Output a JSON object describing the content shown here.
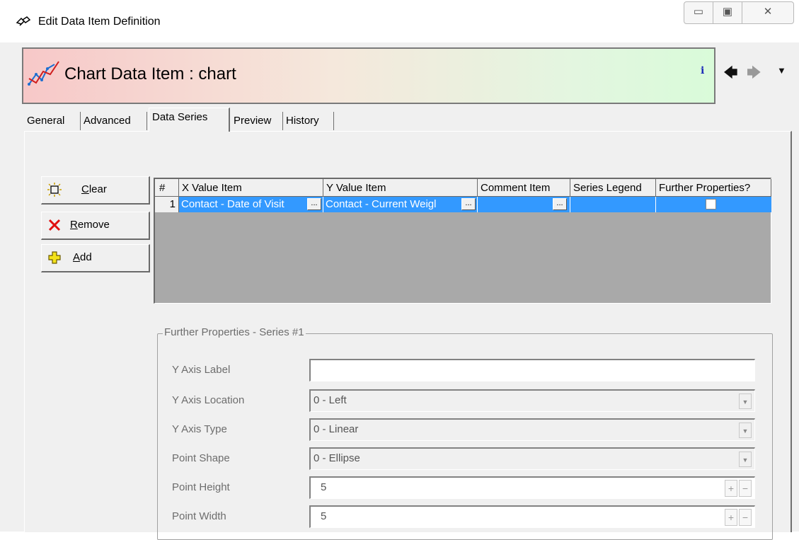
{
  "window": {
    "title": "Edit Data Item Definition",
    "min_glyph": "▭",
    "max_glyph": "▣",
    "close_glyph": "✕"
  },
  "header": {
    "title": "Chart Data Item : chart",
    "info_glyph": "i",
    "back_glyph": "🡄",
    "forward_glyph": "🡆",
    "menu_glyph": "▼"
  },
  "tabs": [
    "General",
    "Advanced",
    "Data Series",
    "Preview",
    "History"
  ],
  "active_tab": "Data Series",
  "actions": {
    "clear": "Clear",
    "remove": "Remove",
    "add": "Add"
  },
  "grid": {
    "columns": [
      "#",
      "X Value Item",
      "Y Value Item",
      "Comment Item",
      "Series Legend",
      "Further Properties?"
    ],
    "rows": [
      {
        "num": "1",
        "x_value": "Contact - Date of Visit",
        "y_value": "Contact - Current Weigl",
        "comment": "",
        "legend": "",
        "further": false,
        "ellipsis": "..."
      }
    ]
  },
  "properties": {
    "legend": "Further Properties - Series #1",
    "y_axis_label": {
      "label": "Y Axis Label",
      "value": ""
    },
    "y_axis_location": {
      "label": "Y Axis Location",
      "value": "0 - Left"
    },
    "y_axis_type": {
      "label": "Y Axis Type",
      "value": "0 - Linear"
    },
    "point_shape": {
      "label": "Point Shape",
      "value": "0 - Ellipse"
    },
    "point_height": {
      "label": "Point Height",
      "value": "5"
    },
    "point_width": {
      "label": "Point Width",
      "value": "5"
    },
    "spin_plus": "+",
    "spin_minus": "−"
  },
  "colors": {
    "selection": "#3399ff",
    "grid_background": "#a9a9a9",
    "info_icon": "#1b2ab8"
  }
}
